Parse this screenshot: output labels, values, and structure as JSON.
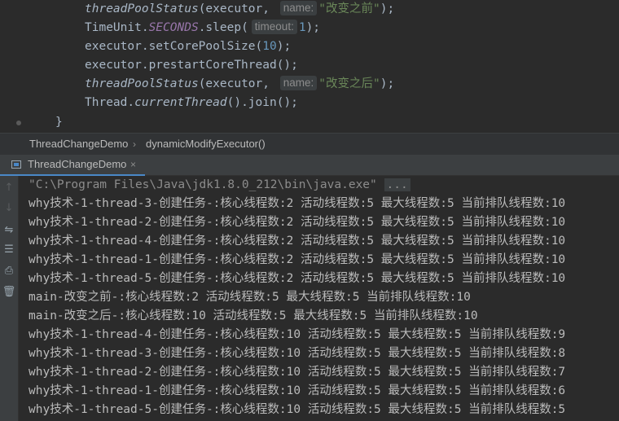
{
  "editor": {
    "lines": [
      {
        "fn": "threadPoolStatus",
        "open": "(executor, ",
        "hint": "name:",
        "str": "\"改变之前\"",
        "close": ");"
      },
      {
        "pre": "TimeUnit.",
        "const": "SECONDS",
        "mid": ".sleep(",
        "hint": "timeout:",
        "num": "1",
        "close": ");"
      },
      {
        "pre": "executor.setCorePoolSize(",
        "num": "10",
        "close": ");"
      },
      {
        "pre": "executor.prestartCoreThread();"
      },
      {
        "fn": "threadPoolStatus",
        "open": "(executor, ",
        "hint": "name:",
        "str": "\"改变之后\"",
        "close": ");"
      },
      {
        "pre": "Thread.",
        "fn": "currentThread",
        "close": "().join();"
      }
    ],
    "closing_brace": "}"
  },
  "breadcrumb": {
    "class_name": "ThreadChangeDemo",
    "separator": "›",
    "method_name": "dynamicModifyExecutor()"
  },
  "run_panel": {
    "tab_label": "ThreadChangeDemo",
    "tab_close": "×"
  },
  "toolbar": {
    "icons": [
      "up-arrow-icon",
      "down-arrow-icon",
      "soft-wrap-icon",
      "scroll-to-end-icon",
      "print-icon",
      "trash-icon"
    ]
  },
  "console": {
    "command": "\"C:\\Program Files\\Java\\jdk1.8.0_212\\bin\\java.exe\"",
    "command_ellipsis": "...",
    "lines": [
      "why技术-1-thread-3-创建任务-:核心线程数:2 活动线程数:5 最大线程数:5 当前排队线程数:10",
      "why技术-1-thread-2-创建任务-:核心线程数:2 活动线程数:5 最大线程数:5 当前排队线程数:10",
      "why技术-1-thread-4-创建任务-:核心线程数:2 活动线程数:5 最大线程数:5 当前排队线程数:10",
      "why技术-1-thread-1-创建任务-:核心线程数:2 活动线程数:5 最大线程数:5 当前排队线程数:10",
      "why技术-1-thread-5-创建任务-:核心线程数:2 活动线程数:5 最大线程数:5 当前排队线程数:10",
      "main-改变之前-:核心线程数:2 活动线程数:5 最大线程数:5 当前排队线程数:10",
      "main-改变之后-:核心线程数:10 活动线程数:5 最大线程数:5 当前排队线程数:10",
      "why技术-1-thread-4-创建任务-:核心线程数:10 活动线程数:5 最大线程数:5 当前排队线程数:9",
      "why技术-1-thread-3-创建任务-:核心线程数:10 活动线程数:5 最大线程数:5 当前排队线程数:8",
      "why技术-1-thread-2-创建任务-:核心线程数:10 活动线程数:5 最大线程数:5 当前排队线程数:7",
      "why技术-1-thread-1-创建任务-:核心线程数:10 活动线程数:5 最大线程数:5 当前排队线程数:6",
      "why技术-1-thread-5-创建任务-:核心线程数:10 活动线程数:5 最大线程数:5 当前排队线程数:5"
    ]
  }
}
